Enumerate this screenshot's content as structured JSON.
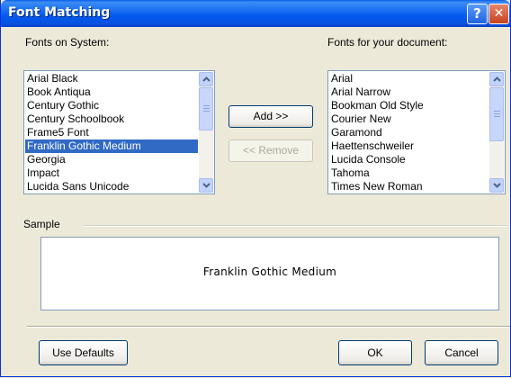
{
  "window": {
    "title": "Font Matching"
  },
  "titlebar": {
    "help_glyph": "?",
    "close_glyph": "✕"
  },
  "system_fonts": {
    "label": "Fonts on System:",
    "items": [
      "Arial Black",
      "Book Antiqua",
      "Century Gothic",
      "Century Schoolbook",
      "Frame5 Font",
      "Franklin Gothic Medium",
      "Georgia",
      "Impact",
      "Lucida Sans Unicode"
    ],
    "selected": "Franklin Gothic Medium"
  },
  "document_fonts": {
    "label": "Fonts for your document:",
    "items": [
      "Arial",
      "Arial Narrow",
      "Bookman Old Style",
      "Courier New",
      "Garamond",
      "Haettenschweiler",
      "Lucida Console",
      "Tahoma",
      "Times New Roman"
    ]
  },
  "buttons": {
    "add": "Add >>",
    "remove": "<< Remove",
    "use_defaults": "Use Defaults",
    "ok": "OK",
    "cancel": "Cancel"
  },
  "sample": {
    "label": "Sample",
    "text": "Franklin Gothic Medium"
  },
  "colors": {
    "selection": "#316ac5",
    "titlebar": "#0058ee",
    "dialog_bg": "#ece9d8"
  },
  "icons": {
    "scroll_up": "chevron-up-icon",
    "scroll_down": "chevron-down-icon",
    "help": "help-icon",
    "close": "close-icon"
  }
}
